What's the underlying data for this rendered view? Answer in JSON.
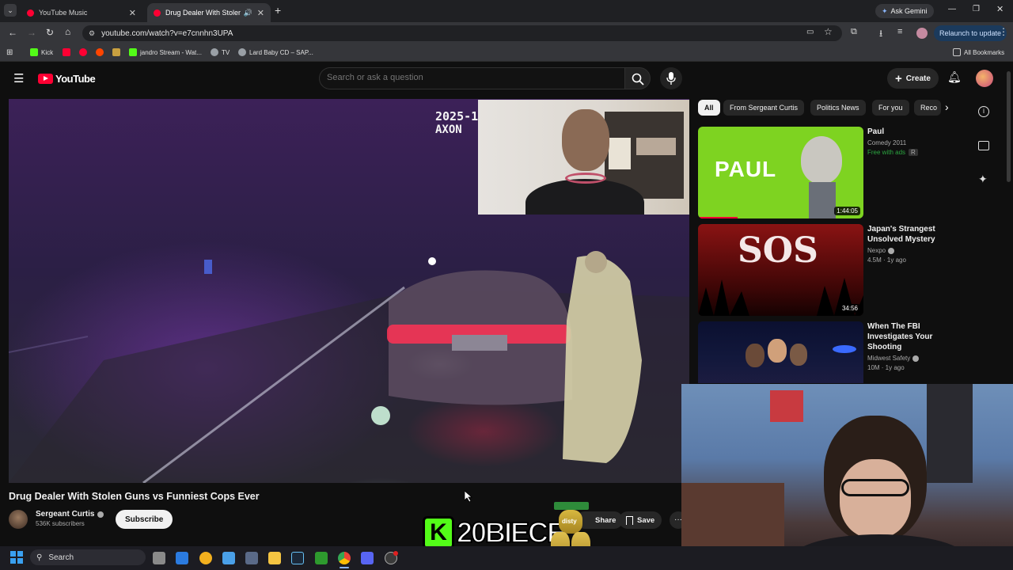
{
  "browser": {
    "tabs": [
      {
        "title": "YouTube Music",
        "active": false
      },
      {
        "title": "Drug Dealer With Stolen G",
        "active": true
      }
    ],
    "ask_gemini": "Ask Gemini",
    "url": "youtube.com/watch?v=e7cnnhn3UPA",
    "relaunch": "Relaunch to update",
    "bookmarks": [
      "Kick",
      "jandro Stream - Wat...",
      "TV",
      "Lard Baby CD – SAP..."
    ],
    "all_bookmarks": "All Bookmarks"
  },
  "youtube": {
    "logo_text": "YouTube",
    "search_placeholder": "Search or ask a question",
    "create_label": "Create",
    "chips": [
      "All",
      "From Sergeant Curtis",
      "Politics News",
      "For you",
      "Reco"
    ],
    "video": {
      "overlay_code": "2025-1",
      "overlay_brand": "AXON",
      "title": "Drug Dealer With Stolen Guns vs Funniest Cops Ever",
      "channel": "Sergeant Curtis",
      "subscribers": "536K subscribers",
      "subscribe": "Subscribe",
      "share": "Share",
      "save": "Save",
      "more": "···"
    },
    "recommendations": [
      {
        "title": "Paul",
        "channel": "Comedy 2011",
        "meta": "Free with ads",
        "rating": "R",
        "duration": "1:44:05",
        "thumb_text": "PAUL"
      },
      {
        "title": "Japan's Strangest Unsolved Mystery",
        "channel": "Nexpo",
        "meta": "4.5M · 1y ago",
        "duration": "34:56",
        "thumb_text": "SOS"
      },
      {
        "title": "When The FBI Investigates Your Shooting",
        "channel": "Midwest Safety",
        "meta": "10M · 1y ago"
      }
    ]
  },
  "overlay": {
    "kick_handle": "20BIECE",
    "kick_letter": "K",
    "can_text": "disty"
  },
  "taskbar": {
    "search": "Search"
  },
  "colors": {
    "yt_red": "#ff0033",
    "kick_green": "#53fc18",
    "chrome_blue": "#8ab4f8"
  }
}
